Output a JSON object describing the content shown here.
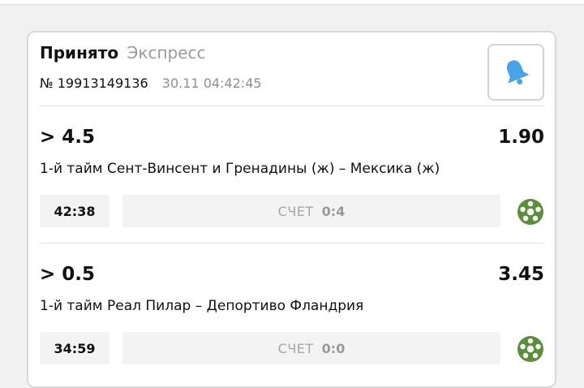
{
  "header": {
    "status": "Принято",
    "bet_type": "Экспресс",
    "bet_number": "№ 19913149136",
    "datetime": "30.11 04:42:45"
  },
  "events": [
    {
      "outcome": "> 4.5",
      "odds": "1.90",
      "match": "1-й тайм Сент-Винсент и Гренадины (ж) – Мексика (ж)",
      "time": "42:38",
      "score_label": "СЧЕТ",
      "score": "0:4",
      "sport_icon": "football-icon"
    },
    {
      "outcome": "> 0.5",
      "odds": "3.45",
      "match": "1-й тайм Реал Пилар – Депортиво Фландрия",
      "time": "34:59",
      "score_label": "СЧЕТ",
      "score": "0:0",
      "sport_icon": "football-icon"
    }
  ],
  "colors": {
    "bell": "#4aa3e8",
    "football": "#5c8f3c"
  }
}
